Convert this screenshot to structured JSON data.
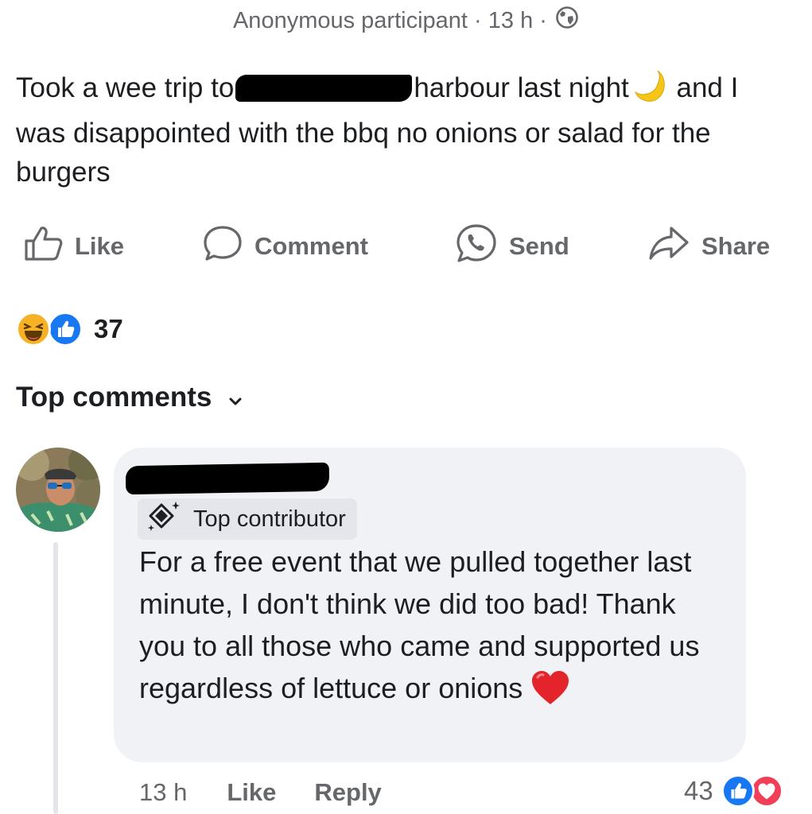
{
  "post": {
    "author": "Anonymous participant",
    "separator": "·",
    "time": "13 h",
    "privacy_icon": "globe-icon",
    "text_part1": "Took a wee trip to",
    "text_part2": "harbour last night",
    "text_part3": "and I was disappointed with the bbq no onions or salad for the burgers",
    "emoji": "crescent-moon"
  },
  "actions": {
    "like": "Like",
    "comment": "Comment",
    "send": "Send",
    "share": "Share"
  },
  "reactions": {
    "types": [
      "haha",
      "like"
    ],
    "count": "37"
  },
  "comments_header": {
    "label": "Top comments"
  },
  "comment": {
    "badge": "Top contributor",
    "text": "For a free event that we pulled together last minute, I don't think we did too bad! Thank you to all those who came and supported us regardless of lettuce or onions",
    "emoji": "red-heart",
    "time": "13 h",
    "like_label": "Like",
    "reply_label": "Reply",
    "reaction_types": [
      "like",
      "love"
    ],
    "reaction_count": "43"
  },
  "colors": {
    "facebook_blue": "#1877f2",
    "love_red": "#f33e58",
    "haha_yellow": "#f7b125",
    "meta_text": "#65676b",
    "bubble_bg": "#f0f2f5"
  }
}
